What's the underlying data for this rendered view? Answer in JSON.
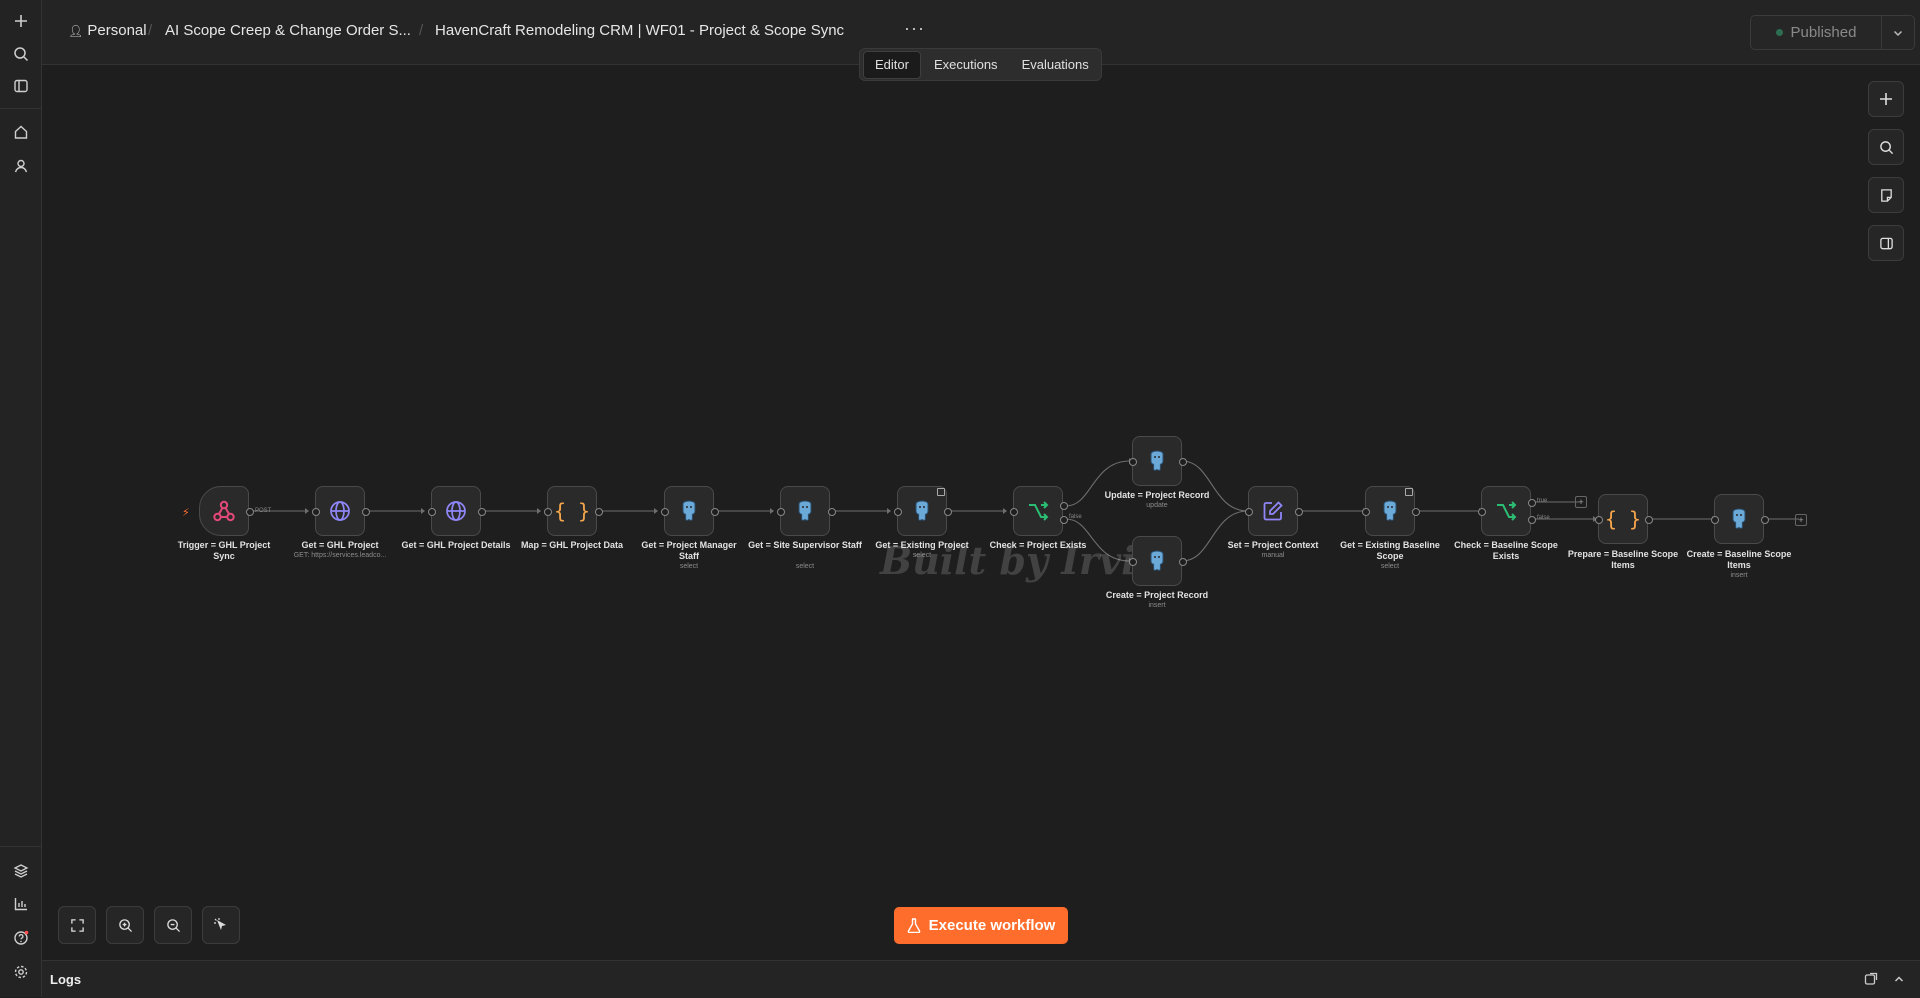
{
  "breadcrumb": {
    "owner": "Personal",
    "folder": "AI Scope Creep & Change Order S...",
    "workflow": "HavenCraft Remodeling CRM | WF01 - Project & Scope Sync",
    "more": "···"
  },
  "status": {
    "label": "Published",
    "color": "#2d6e52"
  },
  "tabs": [
    {
      "label": "Editor",
      "active": true
    },
    {
      "label": "Executions",
      "active": false
    },
    {
      "label": "Evaluations",
      "active": false
    }
  ],
  "watermark": "Built by Irvin",
  "nodes": [
    {
      "id": "n1",
      "label": "Trigger = GHL Project Sync",
      "sub": "",
      "icon": "webhook-icon"
    },
    {
      "id": "n2",
      "label": "Get = GHL Project",
      "sub": "GET: https://services.leadco...",
      "icon": "globe-icon"
    },
    {
      "id": "n3",
      "label": "Get = GHL Project Details",
      "sub": "",
      "icon": "globe-icon"
    },
    {
      "id": "n4",
      "label": "Map = GHL Project Data",
      "sub": "",
      "icon": "code-braces-icon"
    },
    {
      "id": "n5",
      "label": "Get = Project Manager Staff",
      "sub": "select",
      "icon": "postgres-icon"
    },
    {
      "id": "n6",
      "label": "Get = Site Supervisor Staff",
      "sub": "select",
      "icon": "postgres-icon"
    },
    {
      "id": "n7",
      "label": "Get = Existing Project",
      "sub": "select",
      "icon": "postgres-icon"
    },
    {
      "id": "n8",
      "label": "Check = Project Exists",
      "sub": "",
      "icon": "if-branch-icon"
    },
    {
      "id": "n9",
      "label": "Update = Project Record",
      "sub": "update",
      "icon": "postgres-icon"
    },
    {
      "id": "n10",
      "label": "Create = Project Record",
      "sub": "insert",
      "icon": "postgres-icon"
    },
    {
      "id": "n11",
      "label": "Set = Project Context",
      "sub": "manual",
      "icon": "edit-icon"
    },
    {
      "id": "n12",
      "label": "Get = Existing Baseline Scope",
      "sub": "select",
      "icon": "postgres-icon"
    },
    {
      "id": "n13",
      "label": "Check = Baseline Scope Exists",
      "sub": "",
      "icon": "if-branch-icon"
    },
    {
      "id": "n14",
      "label": "Prepare = Baseline Scope Items",
      "sub": "",
      "icon": "code-braces-icon"
    },
    {
      "id": "n15",
      "label": "Create = Baseline Scope Items",
      "sub": "insert",
      "icon": "postgres-icon"
    }
  ],
  "edge_labels": {
    "post": "POST",
    "true": "true",
    "false": "false"
  },
  "execute_label": "Execute workflow",
  "logs_label": "Logs",
  "colors": {
    "accent": "#ff6d2c",
    "webhook": "#e4497a",
    "http": "#8f86f7",
    "code": "#f5a54b",
    "branch": "#2bbd73",
    "postgres": "#6aa9d8",
    "edit": "#8f86f7"
  }
}
